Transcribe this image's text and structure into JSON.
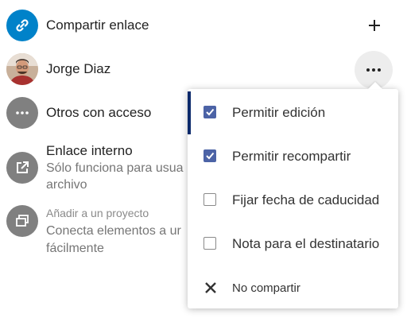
{
  "share_list": {
    "share_link": {
      "label": "Compartir enlace",
      "avatar_color": "#0082c9",
      "avatar_icon": "link-icon",
      "action_icon": "plus-icon"
    },
    "user": {
      "name": "Jorge Diaz",
      "avatar_icon": "user-photo",
      "action_icon": "more-horizontal-icon"
    },
    "others_with_access": {
      "label": "Otros con acceso",
      "avatar_color": "#808080",
      "avatar_icon": "more-horizontal-icon"
    },
    "internal_link": {
      "title": "Enlace interno",
      "description_line1": "Sólo funciona para usua",
      "description_line2": "archivo",
      "avatar_icon": "external-link-icon"
    },
    "project": {
      "add_label": "Añadir a un proyecto",
      "description_line1": "Conecta elementos a ur",
      "description_line2": "fácilmente",
      "avatar_icon": "projects-icon"
    }
  },
  "share_menu": {
    "accent_color": "#4c63a6",
    "items": [
      {
        "label": "Permitir edición",
        "checked": true,
        "active": true,
        "type": "checkbox"
      },
      {
        "label": "Permitir recompartir",
        "checked": true,
        "active": false,
        "type": "checkbox"
      },
      {
        "label": "Fijar fecha de caducidad",
        "checked": false,
        "active": false,
        "type": "checkbox"
      },
      {
        "label": "Nota para el destinatario",
        "checked": false,
        "active": false,
        "type": "checkbox"
      },
      {
        "label": "No compartir",
        "type": "action",
        "icon": "close-icon"
      }
    ]
  }
}
